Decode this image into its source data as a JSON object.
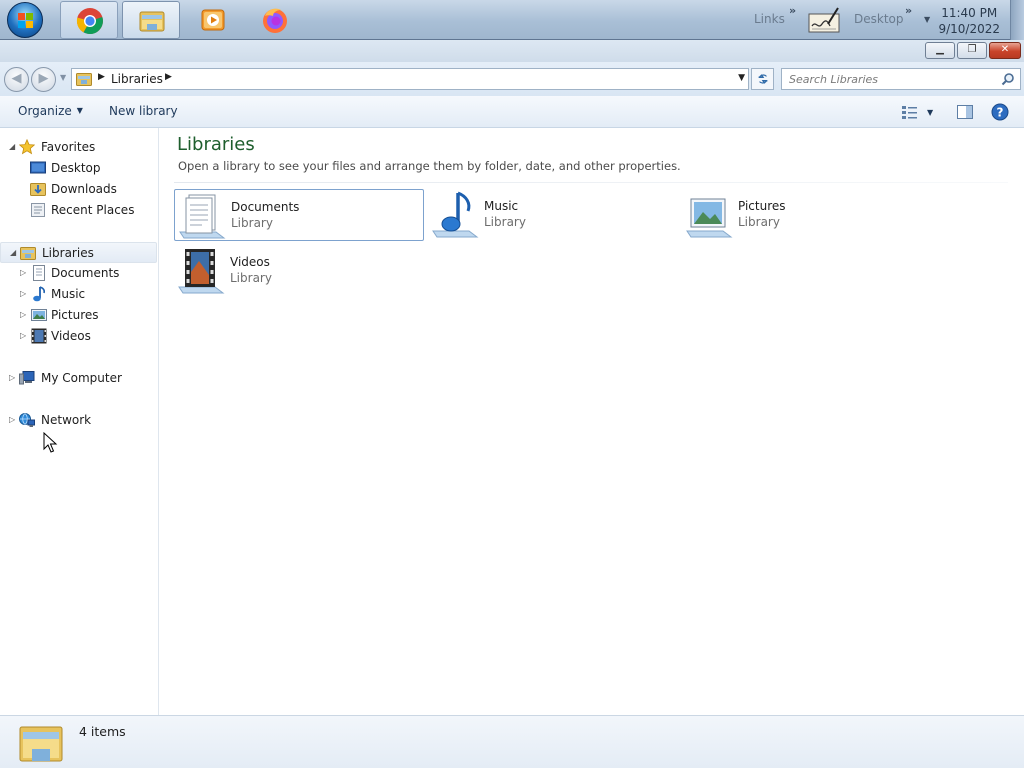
{
  "taskbar": {
    "links_label": "Links",
    "desktop_label": "Desktop",
    "chevron": "»",
    "time": "11:40 PM",
    "date": "9/10/2022"
  },
  "address": {
    "breadcrumb": "Libraries",
    "search_placeholder": "Search Libraries"
  },
  "commands": {
    "organize": "Organize",
    "new_library": "New library"
  },
  "nav": {
    "favorites": "Favorites",
    "desktop": "Desktop",
    "downloads": "Downloads",
    "recent_places": "Recent Places",
    "libraries": "Libraries",
    "documents": "Documents",
    "music": "Music",
    "pictures": "Pictures",
    "videos": "Videos",
    "my_computer": "My Computer",
    "network": "Network"
  },
  "main": {
    "title": "Libraries",
    "subtitle": "Open a library to see your files and arrange them by folder, date, and other properties.",
    "tiles": [
      {
        "name": "Documents",
        "kind": "Library"
      },
      {
        "name": "Music",
        "kind": "Library"
      },
      {
        "name": "Pictures",
        "kind": "Library"
      },
      {
        "name": "Videos",
        "kind": "Library"
      }
    ]
  },
  "status": {
    "item_count": "4 items"
  },
  "icons": [
    "start-orb-icon",
    "chrome-icon",
    "explorer-icon",
    "media-player-icon",
    "firefox-icon",
    "desktop-signature-icon",
    "search-icon",
    "help-icon",
    "refresh-icon",
    "star-icon",
    "folder-icon"
  ]
}
